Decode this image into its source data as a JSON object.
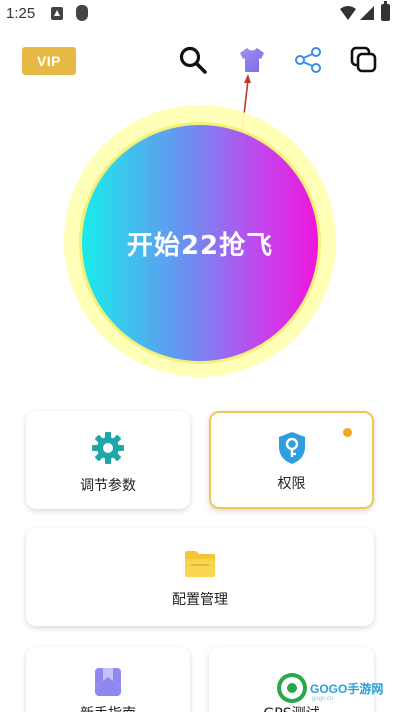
{
  "status_bar": {
    "time": "1:25",
    "icons": [
      "a-icon",
      "shield-icon",
      "wifi-icon",
      "signal-icon",
      "battery-icon"
    ]
  },
  "header": {
    "vip_label": "VIP",
    "icons": [
      "search-icon",
      "tshirt-icon",
      "share-icon",
      "copy-icon"
    ],
    "accent_colors": {
      "vip": "#e6b845",
      "tshirt": "#8e7be8",
      "share": "#3a8ee6"
    }
  },
  "main": {
    "start_button_label": "开始22抢飞",
    "gradient": [
      "#18ecea",
      "#6d8ef1",
      "#c247ee",
      "#ee16dc"
    ],
    "glow_color": "#fff7a6"
  },
  "cards": {
    "params": {
      "label": "调节参数",
      "icon": "gear-icon",
      "color": "#1fa6a8"
    },
    "permission": {
      "label": "权限",
      "icon": "key-shield-icon",
      "color": "#2f9ee0",
      "badge_color": "#f5a623"
    },
    "config": {
      "label": "配置管理",
      "icon": "folder-icon",
      "color": "#f4c534"
    },
    "guide": {
      "label": "新手指南",
      "icon": "bookmark-icon",
      "color": "#8e88f0"
    },
    "test": {
      "label": "GPS测试",
      "icon": "gps-icon"
    }
  },
  "watermark": {
    "text": "GOGO手游网",
    "sub": "gogo.cn"
  }
}
